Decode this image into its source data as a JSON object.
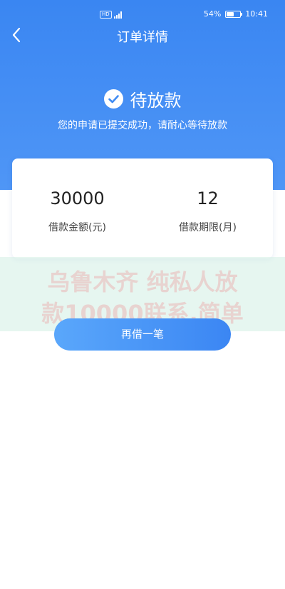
{
  "status_bar": {
    "hd_badge": "HD",
    "signal_label": "4G",
    "battery_percent": "54%",
    "battery_level": 0.54,
    "time": "10:41"
  },
  "nav": {
    "back_icon": "chevron-left-icon",
    "title": "订单详情"
  },
  "hero": {
    "status_icon": "check-circle-icon",
    "status_text": "待放款",
    "subtitle": "您的申请已提交成功，请耐心等待放款"
  },
  "loan_info": {
    "amount_value": "30000",
    "amount_label": "借款金额(元)",
    "term_value": "12",
    "term_label": "借款期限(月)"
  },
  "watermark": {
    "line1": "乌鲁木齐 纯私人放",
    "line2": "款10000联系,简单"
  },
  "actions": {
    "borrow_again_label": "再借一笔"
  },
  "colors": {
    "accent": "#3a86f2",
    "button_gradient_start": "#5aa7fb",
    "button_gradient_end": "#3b86f3"
  }
}
